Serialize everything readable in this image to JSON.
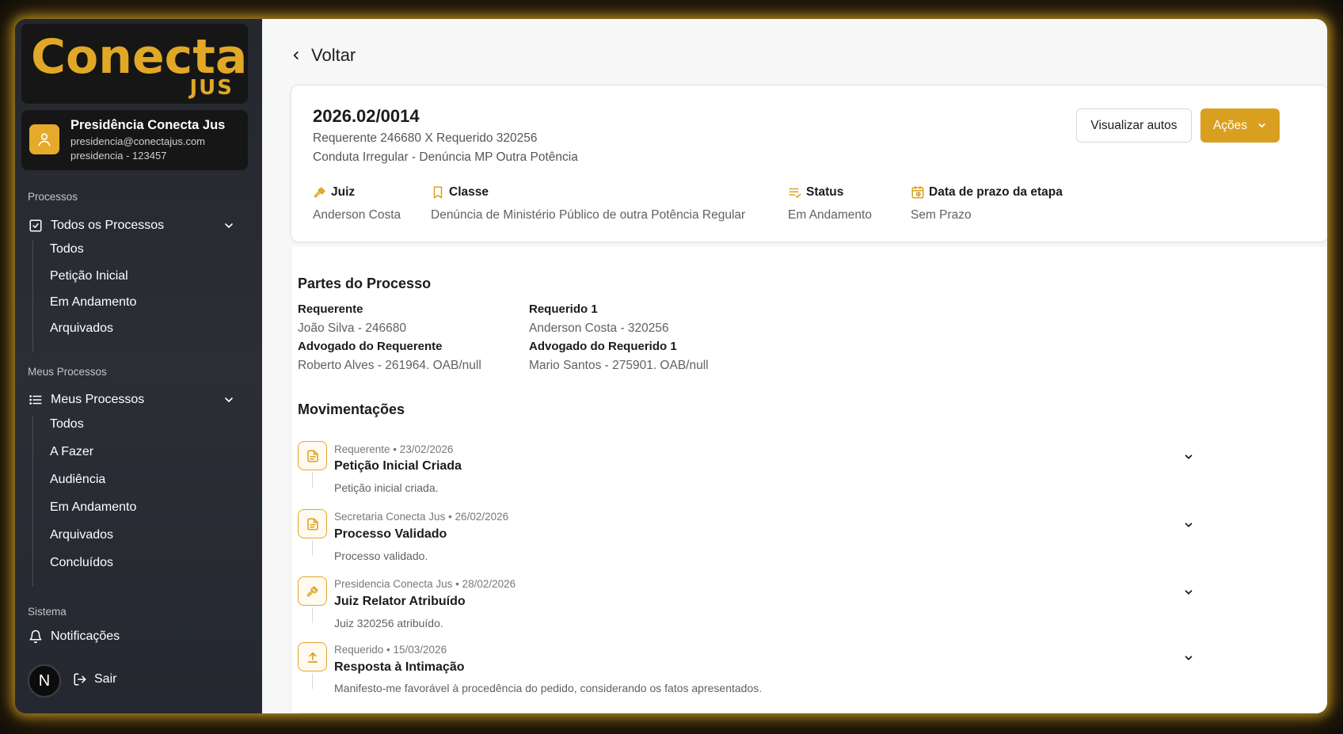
{
  "brand": {
    "logo_word": "Conecta",
    "logo_sub": "JUS"
  },
  "profile": {
    "name": "Presidência Conecta Jus",
    "email": "presidencia@conectajus.com",
    "id_line": "presidencia - 123457"
  },
  "sidebar": {
    "section_processos": "Processos",
    "todos_processos": "Todos os Processos",
    "todos_sub": [
      "Todos",
      "Petição Inicial",
      "Em Andamento",
      "Arquivados"
    ],
    "section_meus": "Meus Processos",
    "meus_processos": "Meus Processos",
    "meus_sub": [
      "Todos",
      "A Fazer",
      "Audiência",
      "Em Andamento",
      "Arquivados",
      "Concluídos"
    ],
    "section_sistema": "Sistema",
    "notificacoes": "Notificações",
    "avatar_initial": "N",
    "logout": "Sair"
  },
  "main": {
    "back_label": "Voltar",
    "process": {
      "number": "2026.02/0014",
      "parties": "Requerente 246680 X Requerido 320256",
      "subject": "Conduta Irregular - Denúncia MP Outra Potência"
    },
    "buttons": {
      "view_label": "Visualizar autos",
      "actions_label": "Ações"
    },
    "meta": {
      "judge_label": "Juiz",
      "judge_value": "Anderson Costa",
      "class_label": "Classe",
      "class_value": "Denúncia de Ministério Público de outra Potência Regular",
      "status_label": "Status",
      "status_value": "Em Andamento",
      "deadline_label": "Data de prazo da etapa",
      "deadline_value": "Sem Prazo"
    },
    "parties_section": {
      "title": "Partes do Processo",
      "requerente_label": "Requerente",
      "requerente_value": "João Silva - 246680",
      "adv_requerente_label": "Advogado do Requerente",
      "adv_requerente_value": "Roberto Alves - 261964. OAB/null",
      "requerido_label": "Requerido 1",
      "requerido_value": "Anderson Costa - 320256",
      "adv_requerido_label": "Advogado do Requerido 1",
      "adv_requerido_value": "Mario Santos - 275901. OAB/null"
    },
    "movements_title": "Movimentações",
    "movements": [
      {
        "icon": "document-icon",
        "meta": "Requerente • 23/02/2026",
        "title": "Petição Inicial Criada",
        "desc": "Petição inicial criada."
      },
      {
        "icon": "document-icon",
        "meta": "Secretaria Conecta Jus • 26/02/2026",
        "title": "Processo Validado",
        "desc": "Processo validado."
      },
      {
        "icon": "gavel-icon",
        "meta": "Presidencia Conecta Jus • 28/02/2026",
        "title": "Juiz Relator Atribuído",
        "desc": "Juiz 320256 atribuído."
      },
      {
        "icon": "upload-icon",
        "meta": "Requerido • 15/03/2026",
        "title": "Resposta à Intimação",
        "desc": "Manifesto-me favorável à procedência do pedido, considerando os fatos apresentados."
      }
    ]
  },
  "colors": {
    "accent": "#d9a020",
    "sidebar_bg": "#2b2e35",
    "glow": "#e2ac2b"
  }
}
